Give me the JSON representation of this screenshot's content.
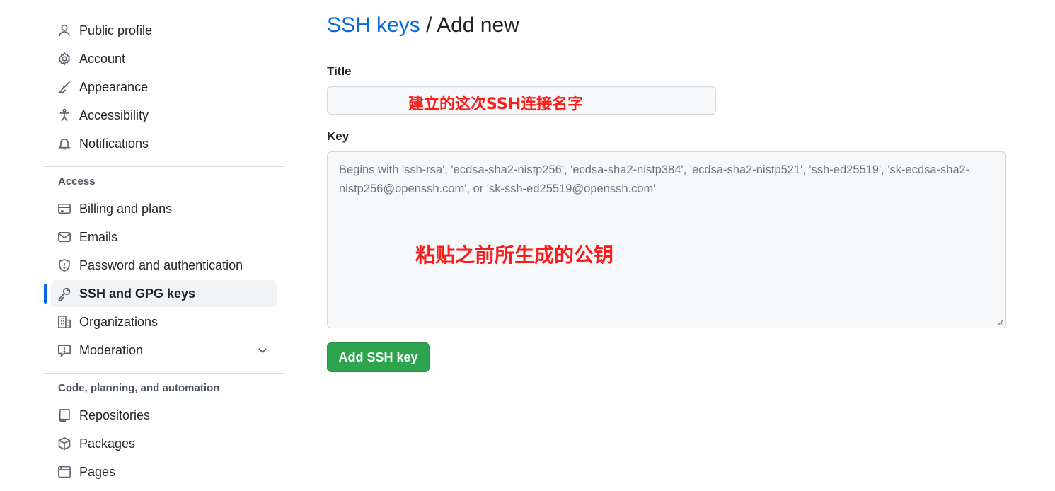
{
  "sidebar": {
    "top_items": [
      {
        "label": "Public profile",
        "icon": "person-icon"
      },
      {
        "label": "Account",
        "icon": "gear-icon"
      },
      {
        "label": "Appearance",
        "icon": "paintbrush-icon"
      },
      {
        "label": "Accessibility",
        "icon": "accessibility-icon"
      },
      {
        "label": "Notifications",
        "icon": "bell-icon"
      }
    ],
    "access_heading": "Access",
    "access_items": [
      {
        "label": "Billing and plans",
        "icon": "credit-card-icon"
      },
      {
        "label": "Emails",
        "icon": "mail-icon"
      },
      {
        "label": "Password and authentication",
        "icon": "shield-icon"
      },
      {
        "label": "SSH and GPG keys",
        "icon": "key-icon",
        "active": true
      },
      {
        "label": "Organizations",
        "icon": "organization-icon"
      },
      {
        "label": "Moderation",
        "icon": "report-icon"
      }
    ],
    "code_heading": "Code, planning, and automation",
    "code_items": [
      {
        "label": "Repositories",
        "icon": "repo-icon"
      },
      {
        "label": "Packages",
        "icon": "package-icon"
      },
      {
        "label": "Pages",
        "icon": "browser-icon"
      }
    ]
  },
  "main": {
    "breadcrumb_link": "SSH keys",
    "breadcrumb_sep": "/",
    "breadcrumb_current": "Add new",
    "title_label": "Title",
    "title_value": "",
    "title_annotation": "建立的这次SSH连接名字",
    "key_label": "Key",
    "key_placeholder": "Begins with 'ssh-rsa', 'ecdsa-sha2-nistp256', 'ecdsa-sha2-nistp384', 'ecdsa-sha2-nistp521', 'ssh-ed25519', 'sk-ecdsa-sha2-nistp256@openssh.com', or 'sk-ssh-ed25519@openssh.com'",
    "key_annotation": "粘贴之前所生成的公钥",
    "submit_label": "Add SSH key"
  },
  "colors": {
    "accent": "#0969da",
    "button": "#2da44e",
    "annotation": "#ff1a1a"
  }
}
